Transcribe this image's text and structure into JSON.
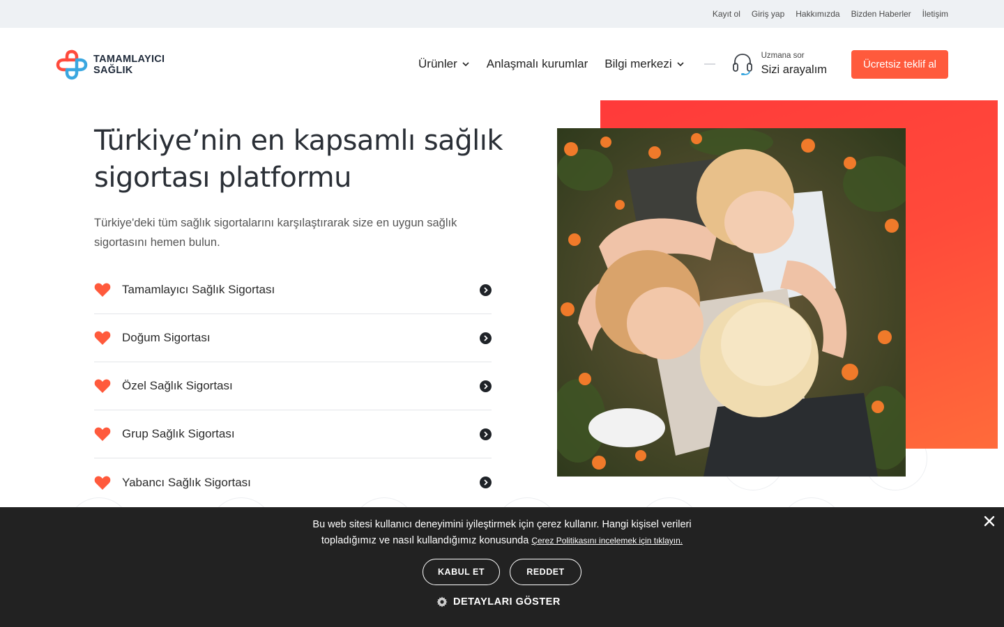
{
  "topbar": {
    "links": [
      "Kayıt ol",
      "Giriş yap",
      "Hakkımızda",
      "Bizden Haberler",
      "İletişim"
    ]
  },
  "header": {
    "logo": {
      "line1": "TAMAMLAYICI",
      "line2": "SAĞLIK",
      "colors": {
        "red": "#ff4a3c",
        "blue": "#3aa7e0"
      }
    },
    "nav": [
      {
        "label": "Ürünler",
        "dropdown": true
      },
      {
        "label": "Anlaşmalı kurumlar",
        "dropdown": false
      },
      {
        "label": "Bilgi merkezi",
        "dropdown": true
      }
    ],
    "expert": {
      "small": "Uzmana sor",
      "big": "Sizi arayalım",
      "icon": "headset-icon"
    },
    "cta": {
      "label": "Ücretsiz teklif al",
      "color": "#ff5a3c"
    }
  },
  "hero": {
    "title": "Türkiye’nin en kapsamlı sağlık sigortası platformu",
    "subtitle": "Türkiye'deki tüm sağlık sigortalarını karşılaştırarak size en uygun sağlık sigortasını hemen bulun.",
    "products": [
      {
        "label": "Tamamlayıcı Sağlık Sigortası"
      },
      {
        "label": "Doğum Sigortası"
      },
      {
        "label": "Özel Sağlık Sigortası"
      },
      {
        "label": "Grup Sağlık Sigortası"
      },
      {
        "label": "Yabancı Sağlık Sigortası"
      }
    ],
    "accent_color": "#ff5a3c",
    "image": "children-hugging-in-flower-field"
  },
  "cookie": {
    "text_line1": "Bu web sitesi kullanıcı deneyimini iyileştirmek için çerez kullanır. Hangi kişisel verileri",
    "text_line2": "topladığımız ve nasıl kullandığımız konusunda",
    "link": "Çerez Politikasını incelemek için tıklayın.",
    "accept": "KABUL ET",
    "reject": "REDDET",
    "details": "DETAYLARI GÖSTER",
    "background": "#222222"
  }
}
